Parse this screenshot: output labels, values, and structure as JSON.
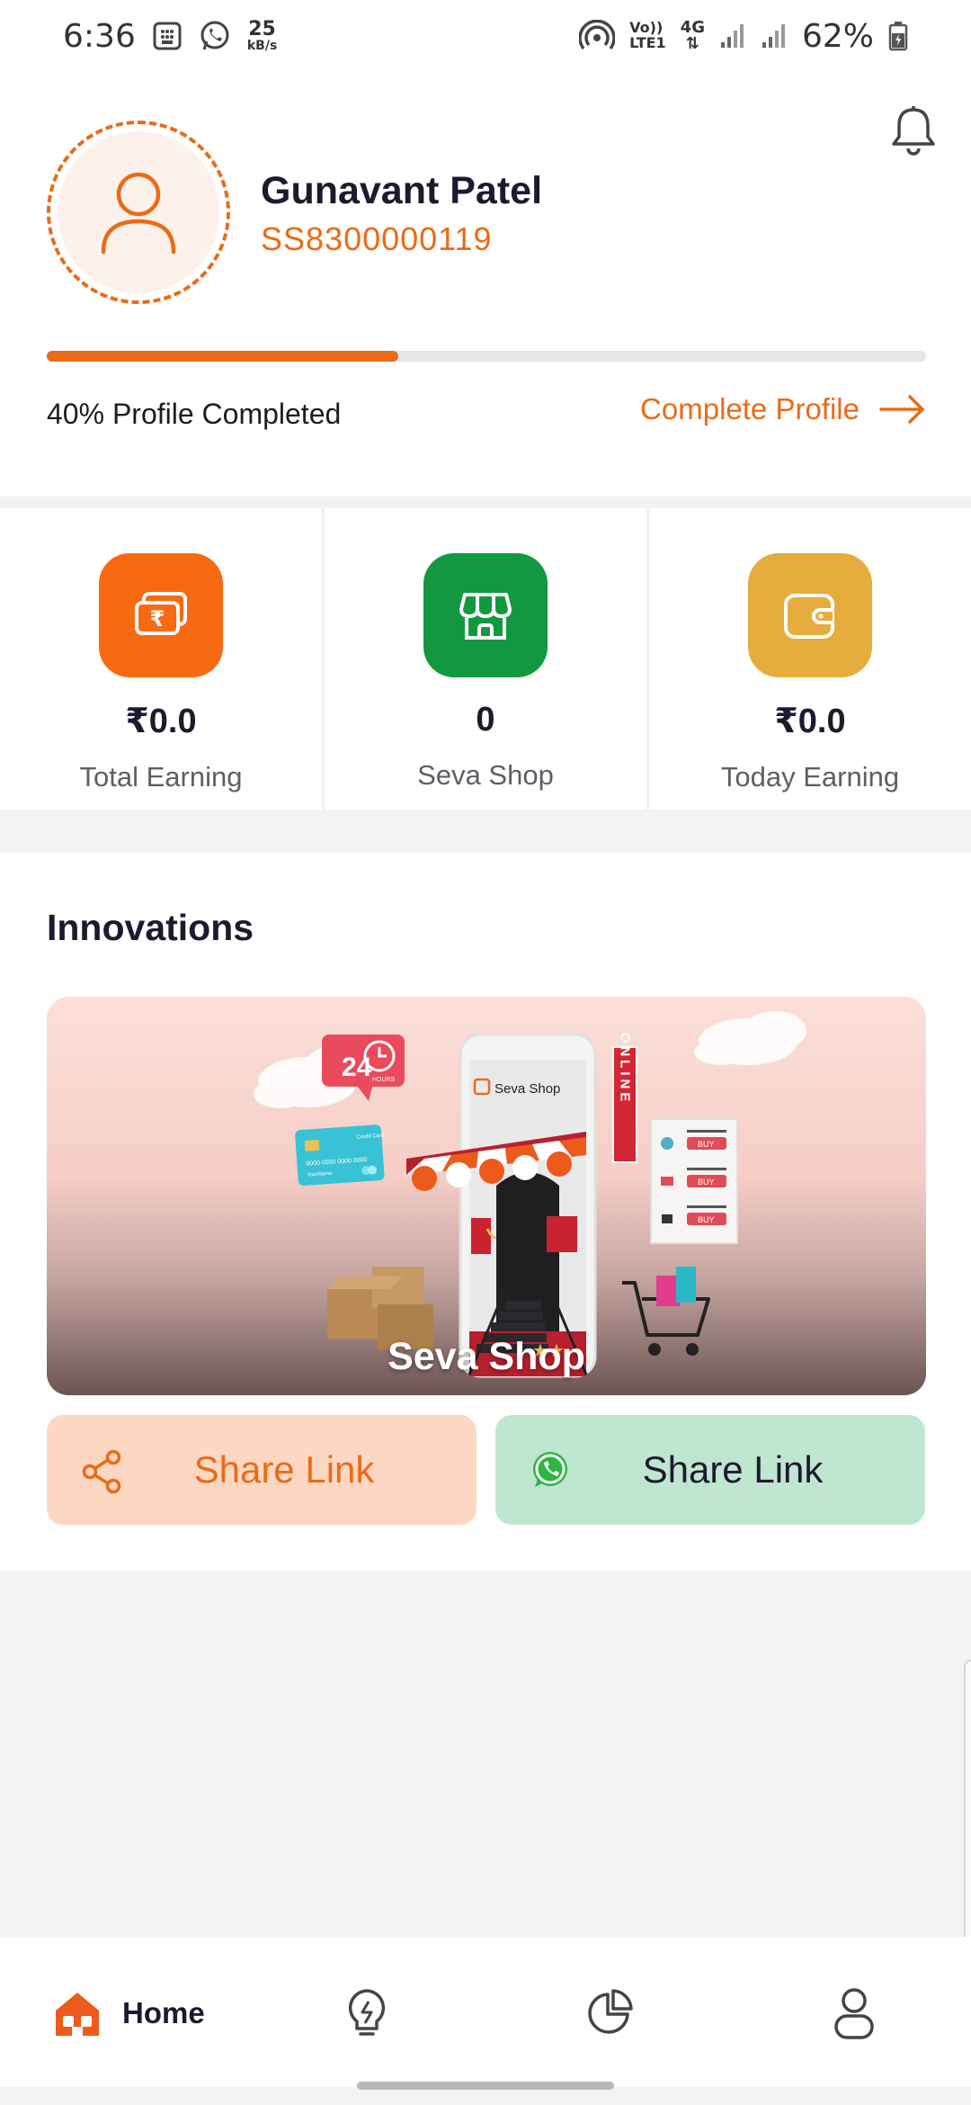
{
  "status_bar": {
    "time": "6:36",
    "net_speed_value": "25",
    "net_speed_unit": "kB/s",
    "volte_top": "Vo))",
    "volte_bottom": "LTE1",
    "network_type": "4G",
    "battery_percent": "62%",
    "icons": [
      "sim-toolkit-icon",
      "whatsapp-icon",
      "hotspot-icon",
      "signal-icon",
      "signal-icon",
      "battery-icon"
    ]
  },
  "profile": {
    "name": "Gunavant Patel",
    "user_id": "SS8300000119",
    "progress_percent": 40,
    "progress_text": "40% Profile Completed",
    "complete_link": "Complete Profile"
  },
  "stats": [
    {
      "value": "₹0.0",
      "label": "Total Earning",
      "color": "#f86a12",
      "icon": "money-stack-icon"
    },
    {
      "value": "0",
      "label": "Seva Shop",
      "color": "#12993f",
      "icon": "shop-icon"
    },
    {
      "value": "₹0.0",
      "label": "Today Earning",
      "color": "#e6ad3e",
      "icon": "wallet-icon"
    }
  ],
  "innovations": {
    "title": "Innovations",
    "banner": {
      "title": "Seva Shop",
      "phone_label": "Seva Shop",
      "badge_24": "24",
      "badge_hours": "HOURS",
      "card_label": "Credit Card",
      "card_number": "0000 0000 0000 0000",
      "card_name": "YourName",
      "online_letters": "ONLINE",
      "buy_label": "BUY"
    },
    "share_buttons": [
      {
        "label": "Share Link",
        "icon": "share-icon",
        "color": "#fcd8c3"
      },
      {
        "label": "Share Link",
        "icon": "whatsapp-icon",
        "color": "#bfe6d0"
      }
    ]
  },
  "bottom_nav": {
    "items": [
      {
        "label": "Home",
        "icon": "home-icon",
        "active": true
      },
      {
        "label": "",
        "icon": "lightbulb-icon",
        "active": false
      },
      {
        "label": "",
        "icon": "pie-chart-icon",
        "active": false
      },
      {
        "label": "",
        "icon": "user-icon",
        "active": false
      }
    ]
  },
  "colors": {
    "accent": "#ec6a16",
    "text_dark": "#1d1a2f"
  }
}
